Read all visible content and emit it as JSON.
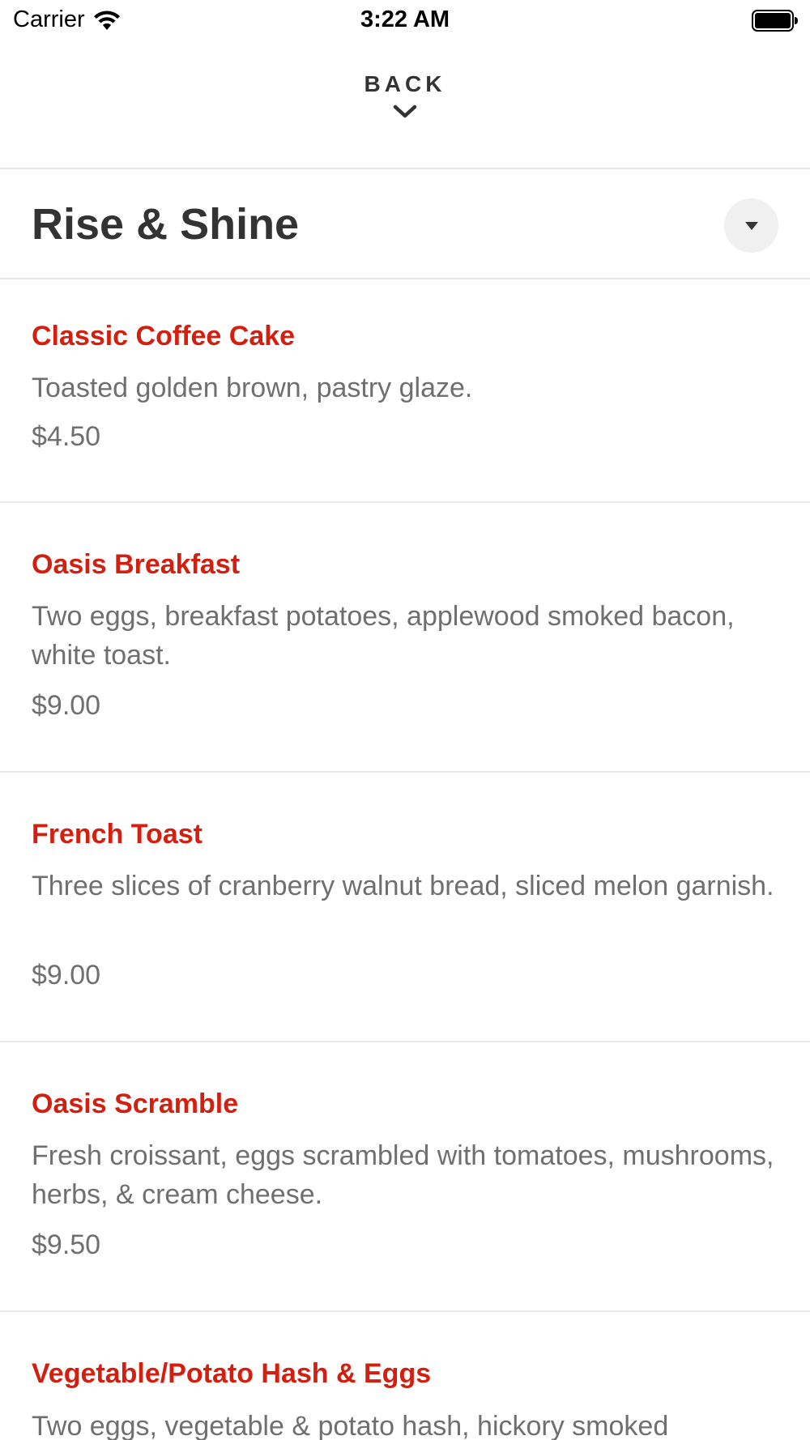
{
  "status_bar": {
    "carrier": "Carrier",
    "time": "3:22 AM"
  },
  "nav": {
    "back_label": "BACK"
  },
  "section": {
    "title": "Rise & Shine"
  },
  "menu_items": [
    {
      "name": "Classic Coffee Cake",
      "description": "Toasted golden brown, pastry glaze.",
      "price": "$4.50"
    },
    {
      "name": "Oasis Breakfast",
      "description": "Two eggs, breakfast potatoes, applewood smoked bacon, white toast.",
      "price": "$9.00"
    },
    {
      "name": "French Toast",
      "description": "Three slices of cranberry walnut bread, sliced melon garnish.",
      "price": "$9.00"
    },
    {
      "name": "Oasis Scramble",
      "description": "Fresh croissant, eggs scrambled with tomatoes, mushrooms, herbs, & cream cheese.",
      "price": "$9.50"
    },
    {
      "name": "Vegetable/Potato Hash & Eggs",
      "description": "Two eggs, vegetable & potato hash, hickory smoked",
      "price": ""
    }
  ],
  "colors": {
    "item_name": "#d31f0f",
    "text_muted": "#6f6f6f",
    "divider": "#e8e8e8"
  },
  "icons": [
    "wifi-icon",
    "battery-icon",
    "chevron-down-icon",
    "caret-down-icon"
  ]
}
